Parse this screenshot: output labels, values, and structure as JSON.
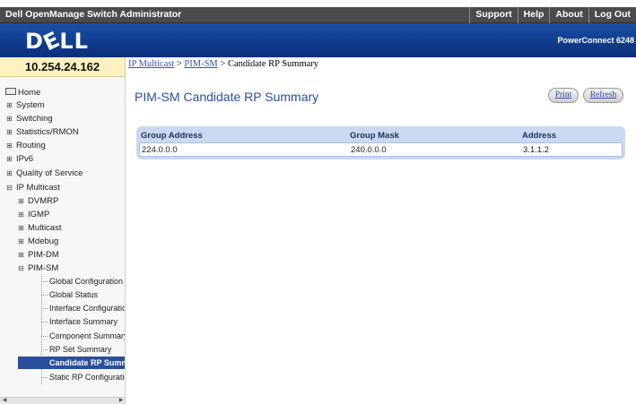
{
  "topbar": {
    "title": "Dell OpenManage Switch Administrator",
    "links": [
      "Support",
      "Help",
      "About",
      "Log Out"
    ]
  },
  "banner": {
    "logo": "DELL",
    "product": "PowerConnect 6248"
  },
  "ip_address": "10.254.24.162",
  "breadcrumb": {
    "items": [
      "IP Multicast",
      "PIM-SM"
    ],
    "separator": ">",
    "current": "Candidate RP Summary"
  },
  "sidebar": {
    "items": [
      {
        "label": "Home",
        "icon": "home-icon"
      },
      {
        "label": "System",
        "icon": "plus-icon"
      },
      {
        "label": "Switching",
        "icon": "plus-icon"
      },
      {
        "label": "Statistics/RMON",
        "icon": "plus-icon"
      },
      {
        "label": "Routing",
        "icon": "plus-icon"
      },
      {
        "label": "IPv6",
        "icon": "plus-icon"
      },
      {
        "label": "Quality of Service",
        "icon": "plus-icon"
      },
      {
        "label": "IP Multicast",
        "icon": "minus-icon"
      },
      {
        "label": "DVMRP",
        "icon": "plus-icon"
      },
      {
        "label": "IGMP",
        "icon": "plus-icon"
      },
      {
        "label": "Multicast",
        "icon": "plus-icon"
      },
      {
        "label": "Mdebug",
        "icon": "plus-icon"
      },
      {
        "label": "PIM-DM",
        "icon": "plus-icon"
      },
      {
        "label": "PIM-SM",
        "icon": "minus-icon"
      }
    ],
    "leaves": [
      "Global Configuration",
      "Global Status",
      "Interface Configuration",
      "Interface Summary",
      "Component Summary",
      "RP Set Summary",
      "Candidate RP Summary",
      "Static RP Configuration"
    ],
    "selected": "Candidate RP Summary"
  },
  "page": {
    "title": "PIM-SM Candidate RP Summary",
    "print_label": "Print",
    "refresh_label": "Refresh"
  },
  "table": {
    "headers": [
      "Group Address",
      "Group Mask",
      "Address"
    ],
    "rows": [
      [
        "224.0.0.0",
        "240.0.0.0",
        "3.1.1.2"
      ]
    ]
  },
  "colors": {
    "topbar": "#4b4b4b",
    "banner": "#1a4fa6",
    "title": "#2a4ea0",
    "selected": "#2a4f9c",
    "table_bg": "#c9d9f2"
  }
}
